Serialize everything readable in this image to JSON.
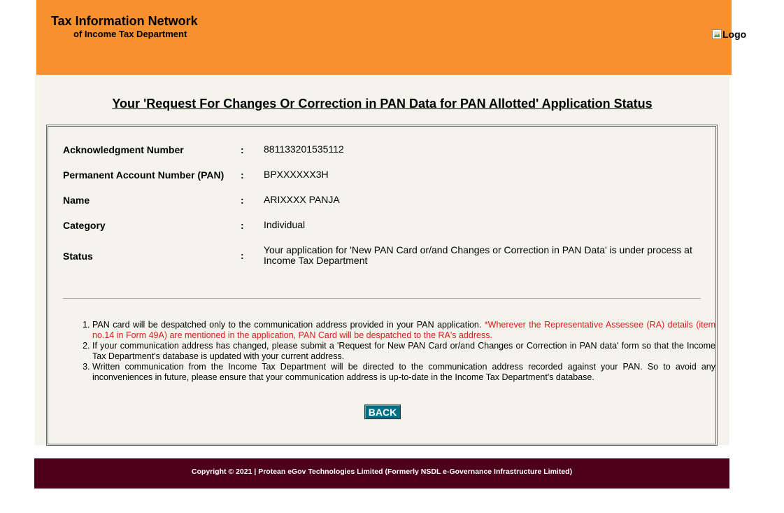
{
  "header": {
    "title": "Tax Information Network",
    "subtitle": "of Income Tax Department",
    "logo_alt": "Logo"
  },
  "page_title": "Your 'Request For Changes Or Correction in PAN Data for PAN Allotted' Application Status",
  "details": {
    "separator": ":",
    "rows": [
      {
        "label": "Acknowledgment Number",
        "value": "881133201535112"
      },
      {
        "label": "Permanent Account Number (PAN)",
        "value": "BPXXXXXX3H"
      },
      {
        "label": "Name",
        "value": "ARIXXXX PANJA"
      },
      {
        "label": "Category",
        "value": "Individual"
      },
      {
        "label": "Status",
        "value": "Your application for 'New PAN Card or/and Changes or Correction in PAN Data' is under process at Income Tax Department"
      }
    ]
  },
  "notes": [
    {
      "text": "PAN card will be despatched only to the communication address provided in your PAN application. ",
      "highlight": "*Wherever the Representative Assessee (RA) details (item no.14 in Form 49A) are mentioned in the application, PAN Card will be despatched to the RA's address."
    },
    {
      "text": "If your communication address has changed, please submit a 'Request for New PAN Card or/and Changes or Correction in PAN data' form so that the Income Tax Department's database is updated with your current address."
    },
    {
      "text": "Written communication from the Income Tax Department will be directed to the communication address recorded against your PAN. So to avoid any inconveniences in future, please ensure that your communication address is up-to-date in the Income Tax Department's database."
    }
  ],
  "back_button": "BACK",
  "footer": "Copyright © 2021 | Protean eGov Technologies Limited (Formerly NSDL e-Governance Infrastructure Limited)",
  "colors": {
    "header_bg": "#f7902f",
    "content_bg": "#f5f4ec",
    "footer_bg": "#4c0019",
    "button_bg": "#006e84",
    "highlight": "#e01b1b"
  }
}
